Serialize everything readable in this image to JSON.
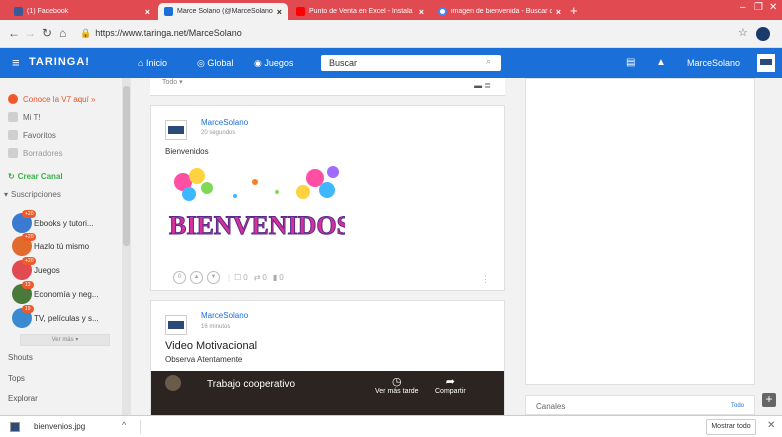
{
  "browser": {
    "tabs": [
      {
        "title": "(1) Facebook",
        "color": "#3b5998"
      },
      {
        "title": "Marce Solano (@MarceSolano) -",
        "color": "#1b6fd8"
      },
      {
        "title": "Punto de Venta en Excel - Instala",
        "color": "#ff0000"
      },
      {
        "title": "imagen de bienvenida - Buscar co",
        "color": "#4285f4"
      }
    ],
    "url_host": "https://www.taringa.net/",
    "url_path": "MarceSolano"
  },
  "nav": {
    "logo": "TARINGA!",
    "inicio": "Inicio",
    "global": "Global",
    "juegos": "Juegos",
    "search_placeholder": "Buscar",
    "username": "MarceSolano"
  },
  "sidebar": {
    "v7": "Conoce la V7 aquí »",
    "mit": "Mi T!",
    "favoritos": "Favoritos",
    "borradores": "Borradores",
    "crear_canal": "Crear Canal",
    "suscripciones": "Suscripciones",
    "subs": [
      {
        "label": "Ebooks y tutori...",
        "badge": "+20"
      },
      {
        "label": "Hazlo tú mismo",
        "badge": "+20"
      },
      {
        "label": "Juegos",
        "badge": "+20"
      },
      {
        "label": "Economía y neg...",
        "badge": "13"
      },
      {
        "label": "TV, películas y s...",
        "badge": "19"
      }
    ],
    "ver_mas": "Ver más",
    "shouts": "Shouts",
    "tops": "Tops",
    "explorar": "Explorar"
  },
  "feed": {
    "filter": "Todo",
    "post1": {
      "author": "MarceSolano",
      "time": "20 segundos",
      "text": "Bienvenidos",
      "banner": "BIENVENIDOS",
      "votes": "0",
      "comments": "0",
      "reshares": "0",
      "saves": "0"
    },
    "post2": {
      "author": "MarceSolano",
      "time": "16 minutos",
      "title": "Video Motivacional",
      "subtitle": "Observa Atentamente",
      "video_title": "Trabajo cooperativo",
      "watch_later": "Ver más tarde",
      "share": "Compartir"
    }
  },
  "right": {
    "canales": "Canales",
    "todo": "Todo"
  },
  "download": {
    "filename": "bienvenios.jpg",
    "show_all": "Mostrar todo"
  }
}
